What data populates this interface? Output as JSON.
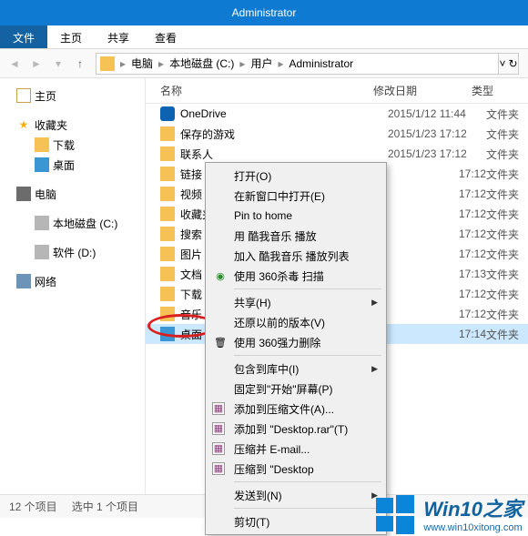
{
  "titlebar": {
    "title": "Administrator"
  },
  "tabs": {
    "file": "文件",
    "home": "主页",
    "share": "共享",
    "view": "查看"
  },
  "breadcrumb": {
    "items": [
      "电脑",
      "本地磁盘 (C:)",
      "用户",
      "Administrator"
    ]
  },
  "sidebar": {
    "home": "主页",
    "favorites": "收藏夹",
    "downloads": "下载",
    "desktop": "桌面",
    "computer": "电脑",
    "drive_c": "本地磁盘 (C:)",
    "drive_d": "软件 (D:)",
    "network": "网络"
  },
  "columns": {
    "name": "名称",
    "date": "修改日期",
    "type": "类型"
  },
  "type_folder": "文件夹",
  "files": [
    {
      "name": "OneDrive",
      "date": "2015/1/12  11:44",
      "icon": "cloud"
    },
    {
      "name": "保存的游戏",
      "date": "2015/1/23 17:12",
      "icon": "folder"
    },
    {
      "name": "联系人",
      "date": "2015/1/23 17:12",
      "icon": "folder"
    },
    {
      "name": "链接",
      "date": "",
      "partialdate": "17:12",
      "icon": "folder"
    },
    {
      "name": "视频",
      "date": "",
      "partialdate": "17:12",
      "icon": "folder"
    },
    {
      "name": "收藏夹",
      "date": "",
      "partialdate": "17:12",
      "icon": "folder"
    },
    {
      "name": "搜索",
      "date": "",
      "partialdate": "17:12",
      "icon": "folder"
    },
    {
      "name": "图片",
      "date": "",
      "partialdate": "17:12",
      "icon": "folder"
    },
    {
      "name": "文档",
      "date": "",
      "partialdate": "17:13",
      "icon": "folder"
    },
    {
      "name": "下载",
      "date": "",
      "partialdate": "17:12",
      "icon": "folder"
    },
    {
      "name": "音乐",
      "date": "",
      "partialdate": "17:12",
      "icon": "folder"
    },
    {
      "name": "桌面",
      "date": "",
      "partialdate": "17:14",
      "icon": "desktop",
      "selected": true
    }
  ],
  "ctxmenu": {
    "open": "打开(O)",
    "open_new": "在新窗口中打开(E)",
    "pin_home": "Pin to home",
    "kugou_play": "用 酷我音乐 播放",
    "kugou_add": "加入 酷我音乐 播放列表",
    "scan_360": "使用 360杀毒 扫描",
    "share": "共享(H)",
    "restore": "还原以前的版本(V)",
    "delete_360": "使用 360强力删除",
    "include_lib": "包含到库中(I)",
    "pin_start": "固定到\"开始\"屏幕(P)",
    "add_rar": "添加到压缩文件(A)...",
    "add_rar_name": "添加到 \"Desktop.rar\"(T)",
    "rar_email": "压缩并 E-mail...",
    "rar_to": "压缩到 \"Desktop",
    "send_to": "发送到(N)",
    "cut": "剪切(T)"
  },
  "status": {
    "count": "12 个项目",
    "selected": "选中 1 个项目"
  },
  "watermark": {
    "title": "Win10之家",
    "url": "www.win10xitong.com"
  }
}
